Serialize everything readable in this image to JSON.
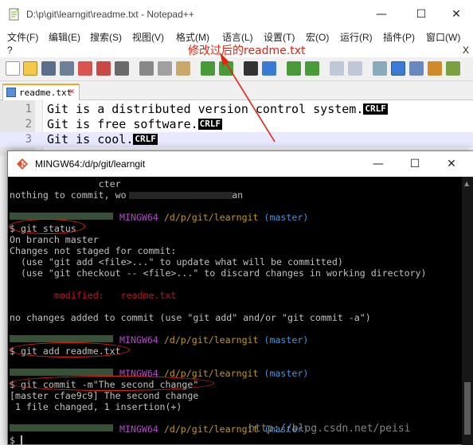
{
  "notepad": {
    "title": "D:\\p\\git\\learngit\\readme.txt - Notepad++",
    "window_controls": {
      "minimize": "—",
      "maximize": "☐",
      "close": "✕"
    },
    "menu": [
      "文件(F)",
      "编辑(E)",
      "搜索(S)",
      "视图(V)",
      "格式(M)",
      "语言(L)",
      "设置(T)",
      "宏(O)",
      "运行(R)",
      "插件(P)",
      "窗口(W)"
    ],
    "menu_help": "?",
    "close_doc": "X",
    "annotation": "修改过后的readme.txt",
    "tab_label": "readme.txt",
    "tab_close": "✕",
    "lines": [
      {
        "num": "1",
        "text": "Git is a distributed version control system."
      },
      {
        "num": "2",
        "text": "Git is free software."
      },
      {
        "num": "3",
        "text": "Git is cool."
      }
    ],
    "eol_marker": "CRLF"
  },
  "terminal": {
    "title": "MINGW64:/d/p/git/learngit",
    "window_controls": {
      "minimize": "—",
      "maximize": "☐",
      "close": "✕"
    },
    "lines": [
      {
        "t": "",
        "seg": [
          {
            "c": "w",
            "x": "                cter"
          }
        ]
      },
      {
        "t": "",
        "seg": [
          {
            "c": "w",
            "x": "nothing to commit, wo                   an"
          }
        ]
      },
      {
        "t": "",
        "seg": []
      },
      {
        "t": "",
        "seg": [
          {
            "c": "mag",
            "x": "MINGW64"
          },
          {
            "c": "yel",
            "x": " /d/p/git/learngit"
          },
          {
            "c": "cyan",
            "x": " (master)"
          }
        ]
      },
      {
        "t": "",
        "seg": [
          {
            "c": "w",
            "x": "$ git status"
          }
        ]
      },
      {
        "t": "",
        "seg": [
          {
            "c": "w",
            "x": "On branch master"
          }
        ]
      },
      {
        "t": "",
        "seg": [
          {
            "c": "w",
            "x": "Changes not staged for commit:"
          }
        ]
      },
      {
        "t": "",
        "seg": [
          {
            "c": "w",
            "x": "  (use \"git add <file>...\" to update what will be committed)"
          }
        ]
      },
      {
        "t": "",
        "seg": [
          {
            "c": "w",
            "x": "  (use \"git checkout -- <file>...\" to discard changes in working directory)"
          }
        ]
      },
      {
        "t": "",
        "seg": []
      },
      {
        "t": "",
        "seg": [
          {
            "c": "red",
            "x": "        modified:   readme.txt"
          }
        ]
      },
      {
        "t": "",
        "seg": []
      },
      {
        "t": "",
        "seg": [
          {
            "c": "w",
            "x": "no changes added to commit (use \"git add\" and/or \"git commit -a\")"
          }
        ]
      },
      {
        "t": "",
        "seg": []
      },
      {
        "t": "",
        "seg": [
          {
            "c": "mag",
            "x": "MINGW64"
          },
          {
            "c": "yel",
            "x": " /d/p/git/learngit"
          },
          {
            "c": "cyan",
            "x": " (master)"
          }
        ]
      },
      {
        "t": "",
        "seg": [
          {
            "c": "w",
            "x": "$ git add readme.txt"
          }
        ]
      },
      {
        "t": "",
        "seg": []
      },
      {
        "t": "",
        "seg": [
          {
            "c": "mag",
            "x": "MINGW64"
          },
          {
            "c": "yel",
            "x": " /d/p/git/learngit"
          },
          {
            "c": "cyan",
            "x": " (master)"
          }
        ]
      },
      {
        "t": "",
        "seg": [
          {
            "c": "w",
            "x": "$ git commit -m\"The second change\""
          }
        ]
      },
      {
        "t": "",
        "seg": [
          {
            "c": "w",
            "x": "[master cfae9c9] The second change"
          }
        ]
      },
      {
        "t": "",
        "seg": [
          {
            "c": "w",
            "x": " 1 file changed, 1 insertion(+)"
          }
        ]
      },
      {
        "t": "",
        "seg": []
      },
      {
        "t": "",
        "seg": [
          {
            "c": "mag",
            "x": "MINGW64"
          },
          {
            "c": "yel",
            "x": " /d/p/git/learngit"
          },
          {
            "c": "cyan",
            "x": " (master)"
          }
        ]
      },
      {
        "t": "",
        "seg": [
          {
            "c": "w",
            "x": "$ "
          }
        ]
      }
    ]
  },
  "watermark": "http://blog.csdn.net/peisi",
  "colors": {
    "annotation_red": "#e8200c",
    "terminal_bg": "#000000",
    "tab_accent": "#f5a623"
  }
}
